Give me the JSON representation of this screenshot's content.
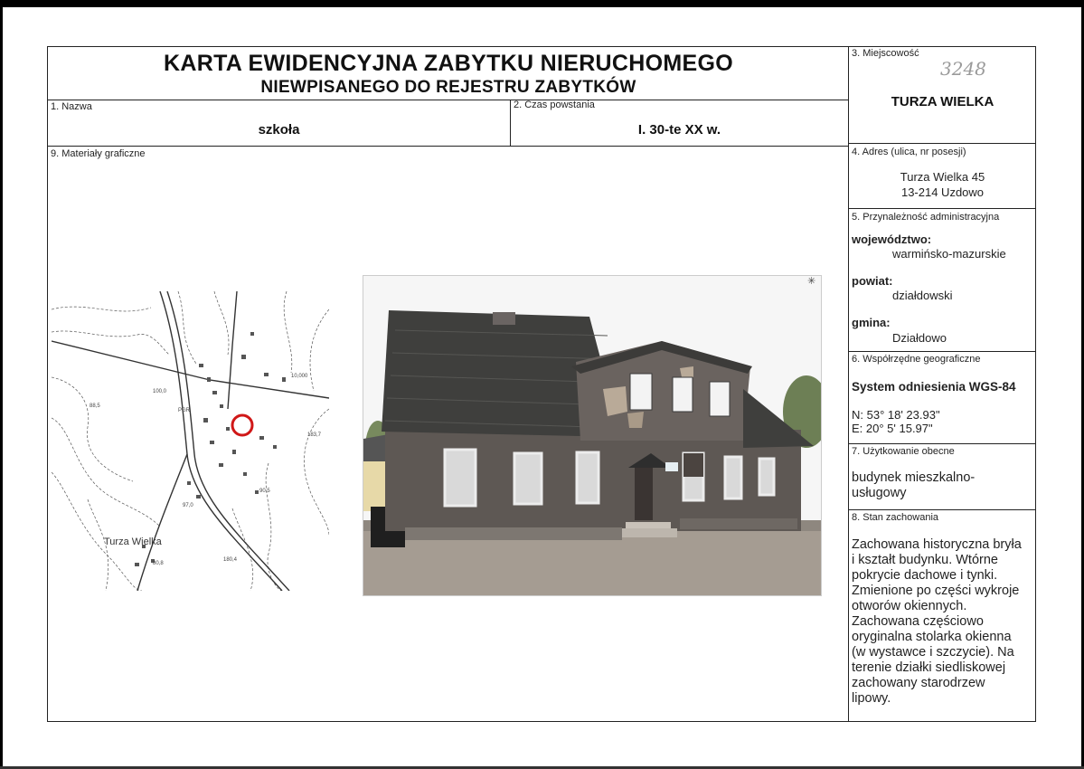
{
  "header": {
    "title": "KARTA EWIDENCYJNA ZABYTKU NIERUCHOMEGO",
    "subtitle": "NIEWPISANEGO DO REJESTRU ZABYTKÓW"
  },
  "fields": {
    "nazwa": {
      "label": "1. Nazwa",
      "value": "szkoła"
    },
    "czas": {
      "label": "2. Czas powstania",
      "value": "I. 30-te XX w."
    },
    "miejscowosc": {
      "label": "3. Miejscowość",
      "value": "TURZA WIELKA",
      "handwritten": "3248"
    },
    "adres": {
      "label": "4. Adres (ulica, nr posesji)",
      "line1": "Turza Wielka 45",
      "line2": "13-214 Uzdowo"
    },
    "administracja": {
      "label": "5. Przynależność administracyjna",
      "wojewodztwo_label": "województwo:",
      "wojewodztwo": "warmińsko-mazurskie",
      "powiat_label": "powiat:",
      "powiat": "działdowski",
      "gmina_label": "gmina:",
      "gmina": "Działdowo"
    },
    "wspolrzedne": {
      "label": "6. Współrzędne geograficzne",
      "system": "System odniesienia WGS-84",
      "n": "N: 53° 18' 23.93\"",
      "e": "E: 20° 5' 15.97\""
    },
    "uzytkowanie": {
      "label": "7. Użytkowanie obecne",
      "line1": "budynek mieszkalno-",
      "line2": "usługowy"
    },
    "stan": {
      "label": "8. Stan zachowania",
      "lines": [
        "Zachowana historyczna bryła",
        "i kształt budynku. Wtórne",
        "pokrycie dachowe i tynki.",
        "Zmienione po części wykroje",
        "otworów okiennych.",
        "Zachowana częściowo",
        "oryginalna stolarka okienna",
        "(w wystawce i szczycie). Na",
        "terenie działki siedliskowej",
        "zachowany starodrzew",
        "lipowy."
      ]
    },
    "materialy": {
      "label": "9. Materiały graficzne"
    }
  },
  "map": {
    "place_label": "Turza Wielka",
    "marker_color": "#d01818"
  },
  "photo": {
    "wall_color": "#5e5854",
    "roof_color": "#3f3f3d",
    "sky_color": "#f6f6f6"
  },
  "colors": {
    "line": "#222222",
    "text": "#111111"
  }
}
